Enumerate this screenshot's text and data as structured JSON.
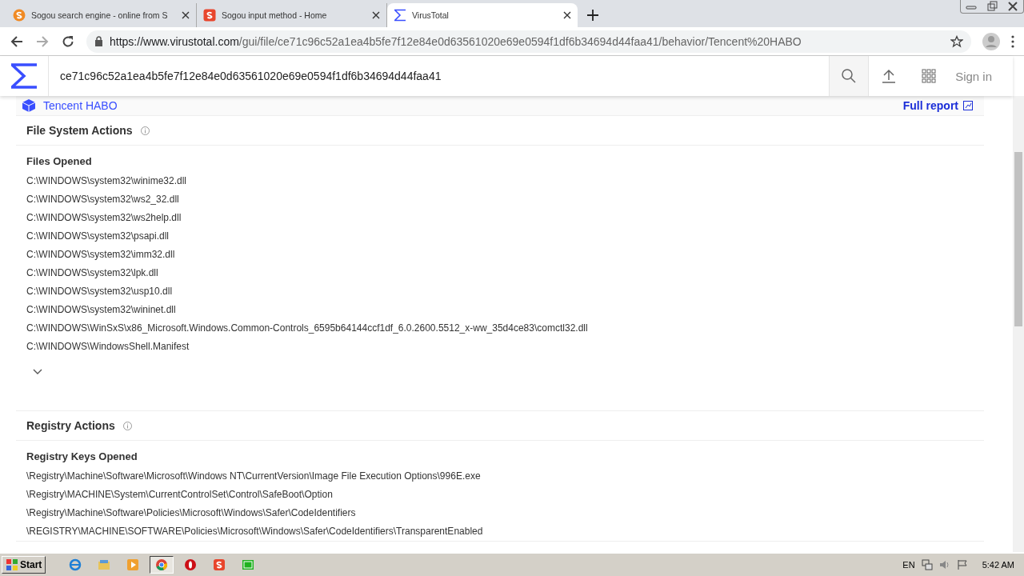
{
  "browser": {
    "tabs": [
      {
        "title": "Sogou search engine - online from S",
        "kind": "sogou-circle",
        "selected": false
      },
      {
        "title": "Sogou input method - Home",
        "kind": "sogou-square",
        "selected": false
      },
      {
        "title": "VirusTotal",
        "kind": "sigma",
        "selected": true
      }
    ],
    "url": {
      "host": "https://www.virustotal.com",
      "path": "/gui/file/ce71c96c52a1ea4b5fe7f12e84e0d63561020e69e0594f1df6b34694d44faa41/behavior/Tencent%20HABO"
    }
  },
  "header": {
    "search_value": "ce71c96c52a1ea4b5fe7f12e84e0d63561020e69e0594f1df6b34694d44faa41",
    "sign_in": "Sign in"
  },
  "sandbox": {
    "name": "Tencent HABO",
    "full_report": "Full report"
  },
  "sections": [
    {
      "title": "File System Actions",
      "subtitle": "Files Opened",
      "items": [
        "C:\\WINDOWS\\system32\\winime32.dll",
        "C:\\WINDOWS\\system32\\ws2_32.dll",
        "C:\\WINDOWS\\system32\\ws2help.dll",
        "C:\\WINDOWS\\system32\\psapi.dll",
        "C:\\WINDOWS\\system32\\imm32.dll",
        "C:\\WINDOWS\\system32\\lpk.dll",
        "C:\\WINDOWS\\system32\\usp10.dll",
        "C:\\WINDOWS\\system32\\wininet.dll",
        "C:\\WINDOWS\\WinSxS\\x86_Microsoft.Windows.Common-Controls_6595b64144ccf1df_6.0.2600.5512_x-ww_35d4ce83\\comctl32.dll",
        "C:\\WINDOWS\\WindowsShell.Manifest"
      ],
      "expandable": true
    },
    {
      "title": "Registry Actions",
      "subtitle": "Registry Keys Opened",
      "items": [
        "\\Registry\\Machine\\Software\\Microsoft\\Windows NT\\CurrentVersion\\Image File Execution Options\\996E.exe",
        "\\Registry\\MACHINE\\System\\CurrentControlSet\\Control\\SafeBoot\\Option",
        "\\Registry\\Machine\\Software\\Policies\\Microsoft\\Windows\\Safer\\CodeIdentifiers",
        "\\REGISTRY\\MACHINE\\SOFTWARE\\Policies\\Microsoft\\Windows\\Safer\\CodeIdentifiers\\TransparentEnabled"
      ],
      "expandable": false
    }
  ],
  "taskbar": {
    "start": "Start",
    "apps": [
      {
        "kind": "ie",
        "selected": false
      },
      {
        "kind": "explorer",
        "selected": false
      },
      {
        "kind": "media",
        "selected": false
      },
      {
        "kind": "chrome",
        "selected": true
      },
      {
        "kind": "opera",
        "selected": false
      },
      {
        "kind": "sogou",
        "selected": false
      },
      {
        "kind": "green",
        "selected": false
      }
    ],
    "language": "EN",
    "time": "5:42 AM"
  }
}
